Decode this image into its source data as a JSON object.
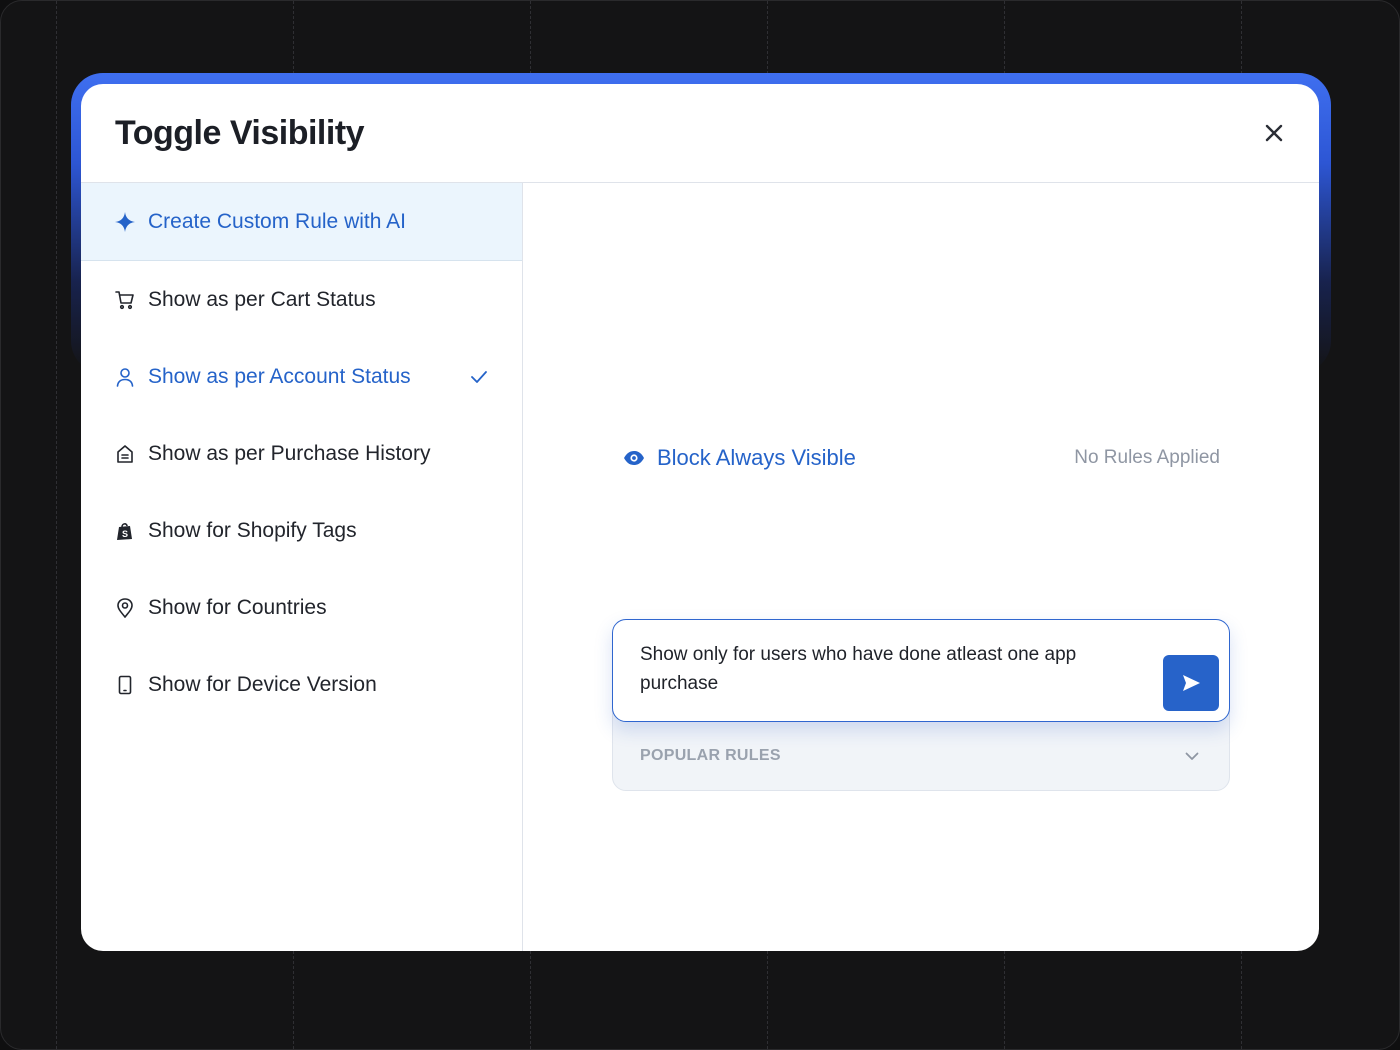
{
  "modal": {
    "title": "Toggle Visibility",
    "close_icon": "close-icon"
  },
  "sidebar": {
    "items": [
      {
        "label": "Create Custom Rule with AI",
        "icon": "sparkle-icon",
        "highlighted": true
      },
      {
        "label": "Show as per Cart Status",
        "icon": "cart-icon"
      },
      {
        "label": "Show as per Account Status",
        "icon": "user-icon",
        "selected": true
      },
      {
        "label": "Show as per Purchase History",
        "icon": "receipt-icon"
      },
      {
        "label": "Show for Shopify Tags",
        "icon": "shopify-bag-icon"
      },
      {
        "label": "Show for Countries",
        "icon": "location-pin-icon"
      },
      {
        "label": "Show for Device Version",
        "icon": "device-icon"
      }
    ]
  },
  "main": {
    "status_label": "Block Always Visible",
    "status_note": "No Rules Applied",
    "prompt_value": "Show only for users who have done atleast one app purchase",
    "popular_rules_label": "POPULAR RULES"
  },
  "colors": {
    "accent": "#2563c9",
    "ai_item_bg": "#ebf5fd",
    "background": "#141415"
  }
}
